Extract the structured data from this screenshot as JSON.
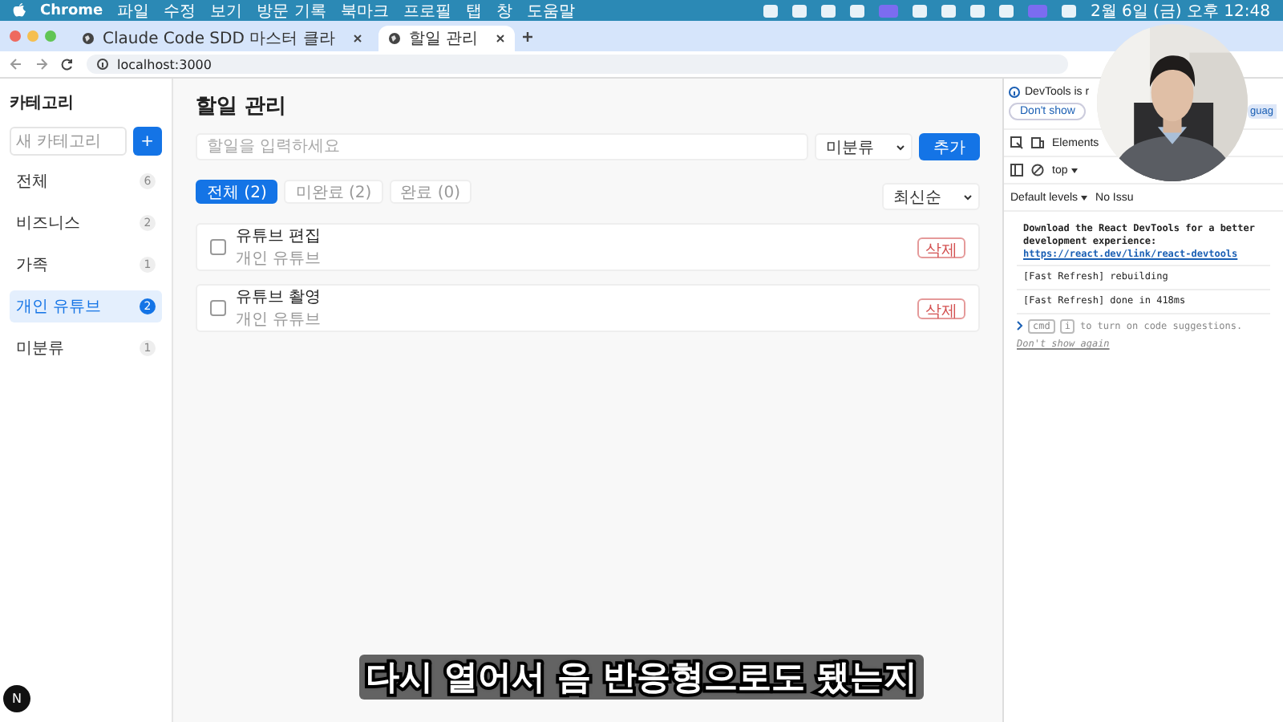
{
  "menu_bar": {
    "app": "Chrome",
    "items": [
      "파일",
      "수정",
      "보기",
      "방문 기록",
      "북마크",
      "프로필",
      "탭",
      "창",
      "도움말"
    ],
    "clock": "2월 6일 (금) 오후 12:48"
  },
  "browser": {
    "tabs": [
      {
        "title": "Claude Code SDD 마스터 클라",
        "selected": false
      },
      {
        "title": "할일 관리",
        "selected": true
      }
    ],
    "url": "localhost:3000"
  },
  "sidebar": {
    "title": "카테고리",
    "placeholder": "새 카테고리",
    "add_button": "+",
    "categories": [
      {
        "name": "전체",
        "count": "6",
        "selected": false
      },
      {
        "name": "비즈니스",
        "count": "2",
        "selected": false
      },
      {
        "name": "가족",
        "count": "1",
        "selected": false
      },
      {
        "name": "개인 유튜브",
        "count": "2",
        "selected": true
      },
      {
        "name": "미분류",
        "count": "1",
        "selected": false
      }
    ]
  },
  "main": {
    "title": "할일 관리",
    "placeholder": "할일을 입력하세요",
    "category_select": "미분류",
    "add_button": "추가",
    "filters": [
      {
        "label": "전체 (2)",
        "selected": true
      },
      {
        "label": "미완료 (2)",
        "selected": false
      },
      {
        "label": "완료 (0)",
        "selected": false
      }
    ],
    "sort": "최신순",
    "todos": [
      {
        "title": "유튜브 편집",
        "category": "개인 유튜브",
        "checked": false,
        "delete": "삭제"
      },
      {
        "title": "유튜브 촬영",
        "category": "개인 유튜브",
        "checked": false,
        "delete": "삭제"
      }
    ]
  },
  "devtools": {
    "banner": "DevTools is r",
    "banner_button": "Don't show",
    "banner_cut": "guag",
    "tab": "Elements",
    "context": "top",
    "levels": "Default levels",
    "issues": "No Issu",
    "messages": [
      {
        "text": "Download the React DevTools for a better development experience: ",
        "link": "https://react.dev/link/react-devtools"
      },
      {
        "text": "[Fast Refresh] rebuilding"
      },
      {
        "text": "[Fast Refresh] done in 418ms"
      }
    ],
    "prompt": {
      "key1": "cmd",
      "key2": "i",
      "text": "to turn on code suggestions.",
      "link": "Don't show again"
    }
  },
  "dev_indicator": "N",
  "subtitle": "다시 열어서 음 반응형으로도 됐는지"
}
